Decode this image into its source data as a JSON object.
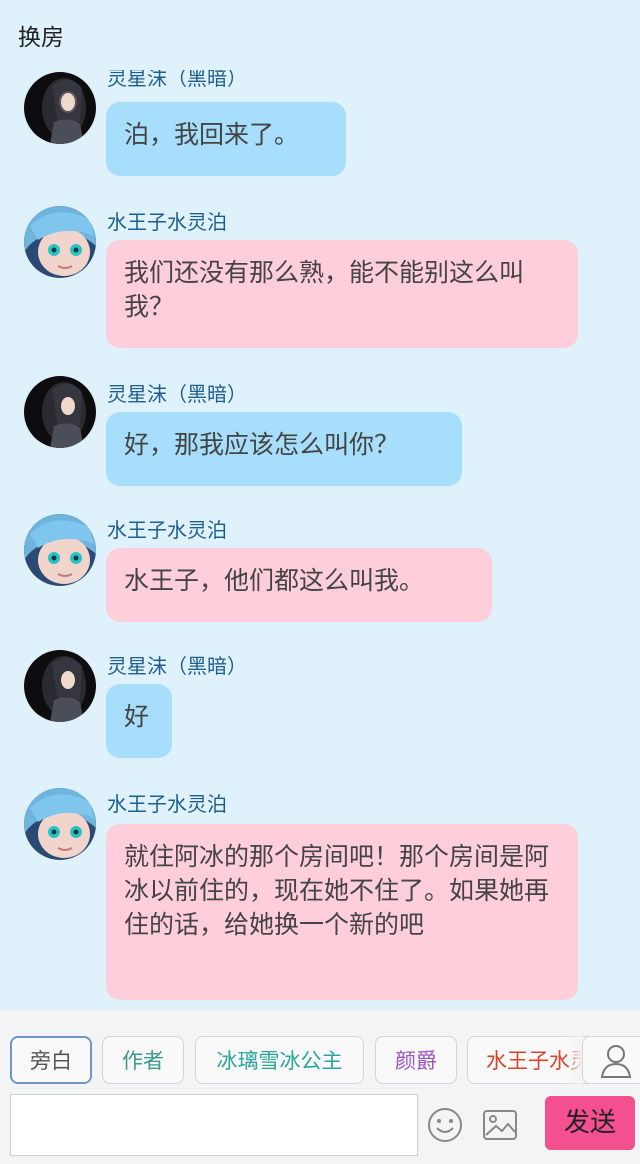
{
  "header": {
    "title": "换房"
  },
  "messages": [
    {
      "sender": "灵星沫（黑暗）",
      "text": "泊，我回来了。",
      "style": "blue",
      "avatar": "girl-avatar"
    },
    {
      "sender": "水王子水灵泊",
      "text": "我们还没有那么熟，能不能别这么叫我？",
      "style": "pink",
      "avatar": "prince-avatar"
    },
    {
      "sender": "灵星沫（黑暗）",
      "text": "好，那我应该怎么叫你？",
      "style": "blue",
      "avatar": "girl-avatar"
    },
    {
      "sender": "水王子水灵泊",
      "text": "水王子，他们都这么叫我。",
      "style": "pink",
      "avatar": "prince-avatar"
    },
    {
      "sender": "灵星沫（黑暗）",
      "text": "好",
      "style": "blue",
      "avatar": "girl-avatar"
    },
    {
      "sender": "水王子水灵泊",
      "text": "就住阿冰的那个房间吧！那个房间是阿冰以前住的，现在她不住了。如果她再住的话，给她换一个新的吧",
      "style": "pink",
      "avatar": "prince-avatar"
    }
  ],
  "characters": [
    {
      "label": "旁白",
      "color": "#555555",
      "selected": true
    },
    {
      "label": "作者",
      "color": "#3d9a8c",
      "selected": false
    },
    {
      "label": "冰璃雪冰公主",
      "color": "#2aa69a",
      "selected": false
    },
    {
      "label": "颜爵",
      "color": "#9b56c4",
      "selected": false
    },
    {
      "label": "水王子水灵泊",
      "color": "#d8432a",
      "selected": false
    }
  ],
  "composer": {
    "placeholder": "",
    "send_label": "发送"
  },
  "icons": {
    "emoji": "smiley-icon",
    "image": "image-icon",
    "user": "user-icon"
  },
  "colors": {
    "bubble_blue": "#a6defc",
    "bubble_pink": "#fecedb",
    "send": "#f44f8e",
    "background": "#dff1fb"
  }
}
